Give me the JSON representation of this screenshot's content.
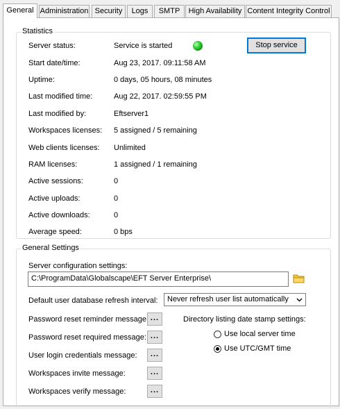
{
  "tabs": [
    "General",
    "Administration",
    "Security",
    "Logs",
    "SMTP",
    "High Availability",
    "Content Integrity Control"
  ],
  "statistics": {
    "title": "Statistics",
    "rows": [
      {
        "label": "Server status:",
        "value": "Service is started"
      },
      {
        "label": "Start date/time:",
        "value": "Aug 23, 2017. 09:11:58 AM"
      },
      {
        "label": "Uptime:",
        "value": "0 days, 05 hours, 08 minutes"
      },
      {
        "label": "Last modified time:",
        "value": "Aug 22, 2017. 02:59:55 PM"
      },
      {
        "label": "Last modified by:",
        "value": "Eftserver1"
      },
      {
        "label": "Workspaces licenses:",
        "value": "5 assigned / 5 remaining"
      },
      {
        "label": "Web clients licenses:",
        "value": "Unlimited"
      },
      {
        "label": "RAM licenses:",
        "value": "1 assigned / 1 remaining"
      },
      {
        "label": "Active sessions:",
        "value": "0"
      },
      {
        "label": "Active uploads:",
        "value": "0"
      },
      {
        "label": "Active downloads:",
        "value": "0"
      },
      {
        "label": "Average speed:",
        "value": "0 bps"
      }
    ],
    "stop_service": "Stop service",
    "status_color": "#2ecc2e"
  },
  "general_settings": {
    "title": "General Settings",
    "config_label": "Server configuration settings:",
    "config_path": "C:\\ProgramData\\Globalscape\\EFT Server Enterprise\\",
    "refresh_label": "Default user database refresh interval:",
    "refresh_value": "Never refresh user list automatically",
    "messages": [
      {
        "label": "Password reset reminder message:"
      },
      {
        "label": "Password reset required message:"
      },
      {
        "label": "User login credentials message:"
      },
      {
        "label": "Workspaces invite message:"
      },
      {
        "label": "Workspaces verify message:"
      }
    ],
    "ellipsis": "...",
    "stamp_label": "Directory listing date stamp settings:",
    "stamp_options": [
      {
        "label": "Use local server time",
        "selected": false
      },
      {
        "label": "Use UTC/GMT time",
        "selected": true
      }
    ]
  },
  "icons": {
    "folder": "folder-icon",
    "status": "status-led-icon",
    "dropdown": "chevron-down-icon"
  }
}
